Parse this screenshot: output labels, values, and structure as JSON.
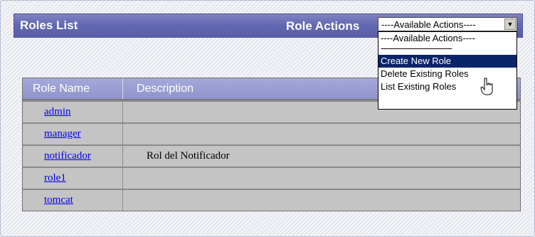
{
  "header": {
    "title": "Roles List",
    "actions_label": "Role Actions"
  },
  "actions_select": {
    "value": "----Available Actions----",
    "options": [
      "----Available Actions----",
      "------------------------------",
      "Create New Role",
      "Delete Existing Roles",
      "List Existing Roles"
    ],
    "highlighted": "Create New Role"
  },
  "table": {
    "headers": {
      "name": "Role Name",
      "description": "Description"
    },
    "rows": [
      {
        "name": "admin",
        "description": ""
      },
      {
        "name": "manager",
        "description": ""
      },
      {
        "name": "notificador",
        "description": "Rol del Notificador"
      },
      {
        "name": "role1",
        "description": ""
      },
      {
        "name": "tomcat",
        "description": ""
      }
    ]
  },
  "colors": {
    "header_bg": "#6167b0",
    "table_header_bg": "#a5a8d9",
    "row_bg": "#c4c4c4",
    "selected_option_bg": "#0a246a",
    "link": "#0000ee"
  }
}
